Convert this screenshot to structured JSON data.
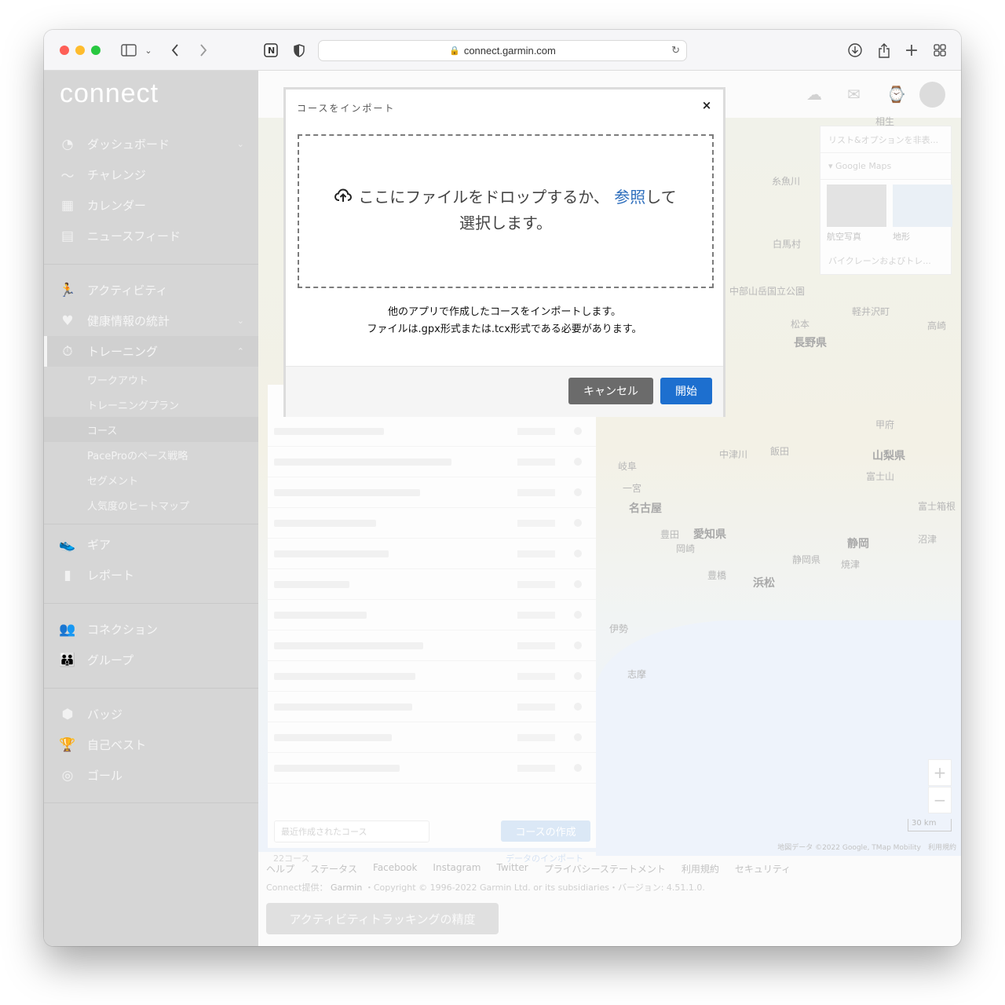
{
  "browser": {
    "url": "connect.garmin.com"
  },
  "sidebar": {
    "logo": "connect",
    "groups": [
      [
        {
          "label": "ダッシュボード",
          "icon": "dashboard-icon",
          "chevron": "⌄"
        },
        {
          "label": "チャレンジ",
          "icon": "challenge-icon",
          "chevron": ""
        },
        {
          "label": "カレンダー",
          "icon": "calendar-icon",
          "chevron": ""
        },
        {
          "label": "ニュースフィード",
          "icon": "newsfeed-icon",
          "chevron": ""
        }
      ],
      [
        {
          "label": "アクティビティ",
          "icon": "activity-icon",
          "chevron": ""
        },
        {
          "label": "健康情報の統計",
          "icon": "heart-icon",
          "chevron": "⌄"
        },
        {
          "label": "トレーニング",
          "icon": "stopwatch-icon",
          "chevron": "⌃"
        }
      ]
    ],
    "training_subitems": [
      "ワークアウト",
      "トレーニングプラン",
      "コース",
      "PaceProのペース戦略",
      "セグメント",
      "人気度のヒートマップ"
    ],
    "group3": [
      {
        "label": "ギア",
        "icon": "shoe-icon"
      },
      {
        "label": "レポート",
        "icon": "bar-chart-icon"
      }
    ],
    "group4": [
      {
        "label": "コネクション",
        "icon": "people-icon"
      },
      {
        "label": "グループ",
        "icon": "group-icon"
      }
    ],
    "group5": [
      {
        "label": "バッジ",
        "icon": "badge-icon"
      },
      {
        "label": "自己ベスト",
        "icon": "trophy-icon"
      },
      {
        "label": "ゴール",
        "icon": "target-icon"
      }
    ]
  },
  "map": {
    "type_panel": {
      "list_option": "リスト&オプションを非表...",
      "provider": "Google Maps",
      "thumb_satellite": "航空写真",
      "thumb_terrain": "地形",
      "bike_lanes": "バイクレーンおよびトレ..."
    },
    "labels": [
      "糸魚川",
      "白馬村",
      "中部山岳国立公園",
      "松本",
      "長野県",
      "甲府",
      "山梨県",
      "富士山",
      "富士箱根",
      "岐阜",
      "中津川",
      "飯田",
      "一宮",
      "名古屋",
      "愛知県",
      "豊田",
      "岡崎",
      "静岡",
      "静岡県",
      "浜松",
      "豊橋",
      "伊勢",
      "志摩",
      "焼津",
      "沼津",
      "高崎",
      "軽井沢町",
      "相生"
    ],
    "scale": "30 km",
    "attribution": "地図データ ©2022 Google, TMap Mobility　利用規約",
    "zoom_in": "+",
    "zoom_out": "−"
  },
  "course_list": {
    "sort_label": "最近作成されたコース",
    "create_button": "コースの作成",
    "count": "22コース",
    "import_link": "データのインポート"
  },
  "footer": {
    "links": [
      "ヘルプ",
      "ステータス",
      "Facebook",
      "Instagram",
      "Twitter",
      "プライバシーステートメント",
      "利用規約",
      "セキュリティ"
    ],
    "provided_by": "Connect提供：",
    "brand": "Garmin",
    "copyright_rest": "・Copyright © 1996-2022 Garmin Ltd. or its subsidiaries・バージョン: 4.51.1.0.",
    "accuracy_button": "アクティビティトラッキングの精度"
  },
  "modal": {
    "title": "コースをインポート",
    "close": "×",
    "drop_text_before": "ここにファイルをドロップするか、",
    "browse_link": "参照",
    "drop_text_after": "して",
    "drop_text_line2": "選択します。",
    "desc_line1": "他のアプリで作成したコースをインポートします。",
    "desc_line2": "ファイルは.gpx形式または.tcx形式である必要があります。",
    "cancel_button": "キャンセル",
    "start_button": "開始"
  },
  "colors": {
    "primary_blue": "#1d6fcf",
    "cancel_gray": "#6b6b6b",
    "sidebar_gray": "#d6d6d6"
  }
}
